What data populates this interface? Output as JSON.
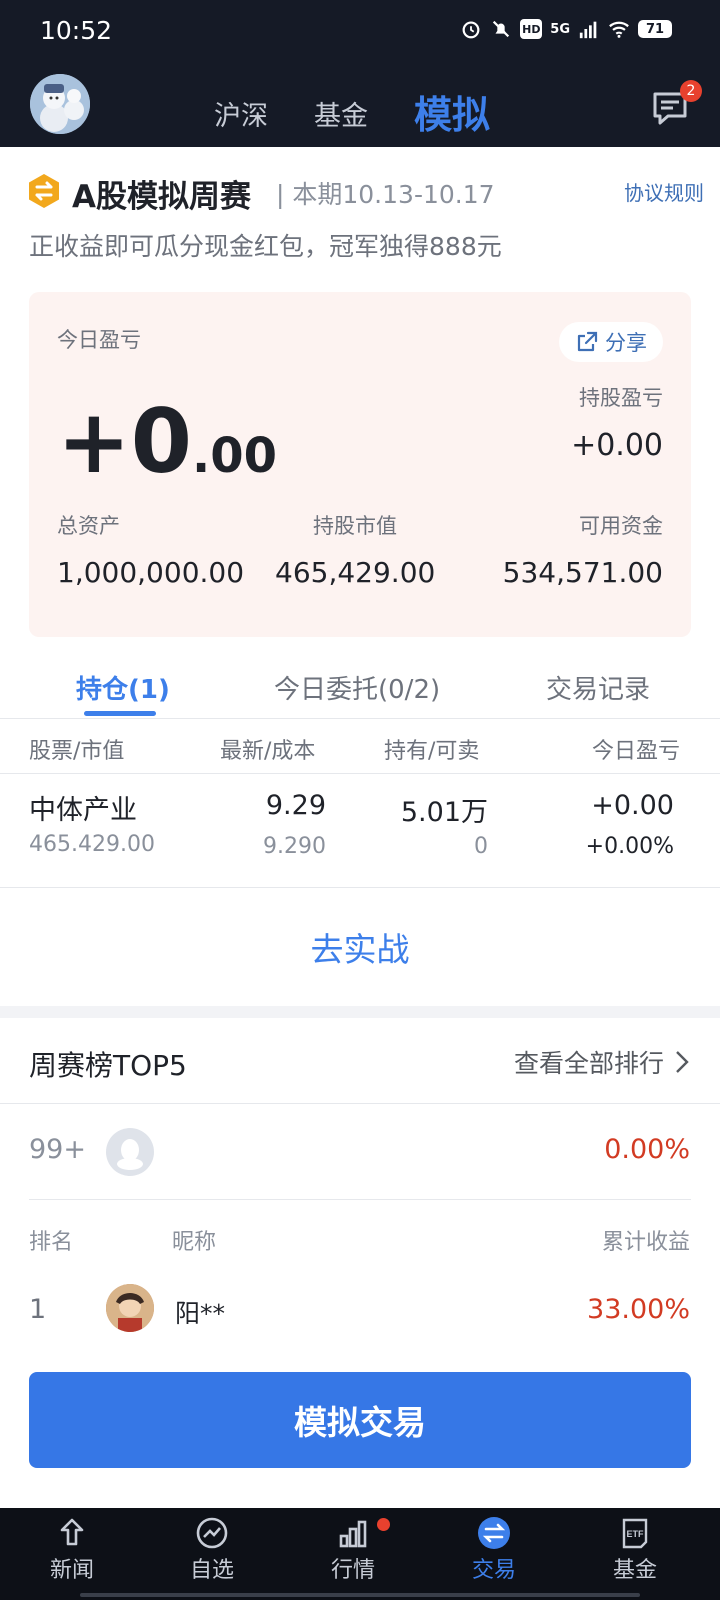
{
  "status_bar": {
    "time": "10:52",
    "network": "5G",
    "hd": "HD",
    "battery": "71"
  },
  "header": {
    "tabs": [
      {
        "label": "沪深"
      },
      {
        "label": "基金"
      },
      {
        "label": "模拟"
      }
    ],
    "active_tab": "模拟",
    "message_count": "2",
    "icons": {
      "avatar": "avatar-snowman",
      "messages": "message-icon"
    }
  },
  "contest": {
    "title": "A股模拟周赛",
    "period": "| 本期10.13-10.17",
    "rules_link": "协议规则",
    "subtitle": "正收益即可瓜分现金红包，冠军独得888元"
  },
  "pnl_card": {
    "today_label": "今日盈亏",
    "share_label": "分享",
    "today_int": "+0",
    "today_dec": ".00",
    "holding_pnl_label": "持股盈亏",
    "holding_pnl_value": "+0.00",
    "total_assets_label": "总资产",
    "total_assets_value": "1,000,000.00",
    "market_value_label": "持股市值",
    "market_value_value": "465,429.00",
    "available_cash_label": "可用资金",
    "available_cash_value": "534,571.00"
  },
  "position_tabs": [
    {
      "label": "持仓(1)"
    },
    {
      "label": "今日委托(0/2)"
    },
    {
      "label": "交易记录"
    }
  ],
  "table": {
    "headers": [
      "股票/市值",
      "最新/成本",
      "持有/可卖",
      "今日盈亏"
    ],
    "rows": [
      {
        "name": "中体产业",
        "market_value": "465.429.00",
        "latest": "9.29",
        "cost": "9.290",
        "holding": "5.01万",
        "sellable": "0",
        "today_pnl": "+0.00",
        "today_pnl_pct": "+0.00%"
      }
    ]
  },
  "go_real_label": "去实战",
  "leaderboard": {
    "title": "周赛榜TOP5",
    "view_all": "查看全部排行",
    "my_rank": "99+",
    "my_return": "0.00%",
    "col_rank": "排名",
    "col_nick": "昵称",
    "col_return": "累计收益",
    "entries": [
      {
        "rank": "1",
        "nickname": "阳**",
        "return": "33.00%"
      }
    ]
  },
  "sim_trade_button": "模拟交易",
  "bottom_nav": [
    {
      "label": "新闻",
      "icon": "news-icon"
    },
    {
      "label": "自选",
      "icon": "watchlist-icon"
    },
    {
      "label": "行情",
      "icon": "market-icon"
    },
    {
      "label": "交易",
      "icon": "trade-icon"
    },
    {
      "label": "基金",
      "icon": "etf-icon"
    }
  ],
  "colors": {
    "accent": "#3d7fea",
    "up_red": "#d23b23",
    "header_bg": "#151a26",
    "card_bg": "#fdf3f1"
  }
}
